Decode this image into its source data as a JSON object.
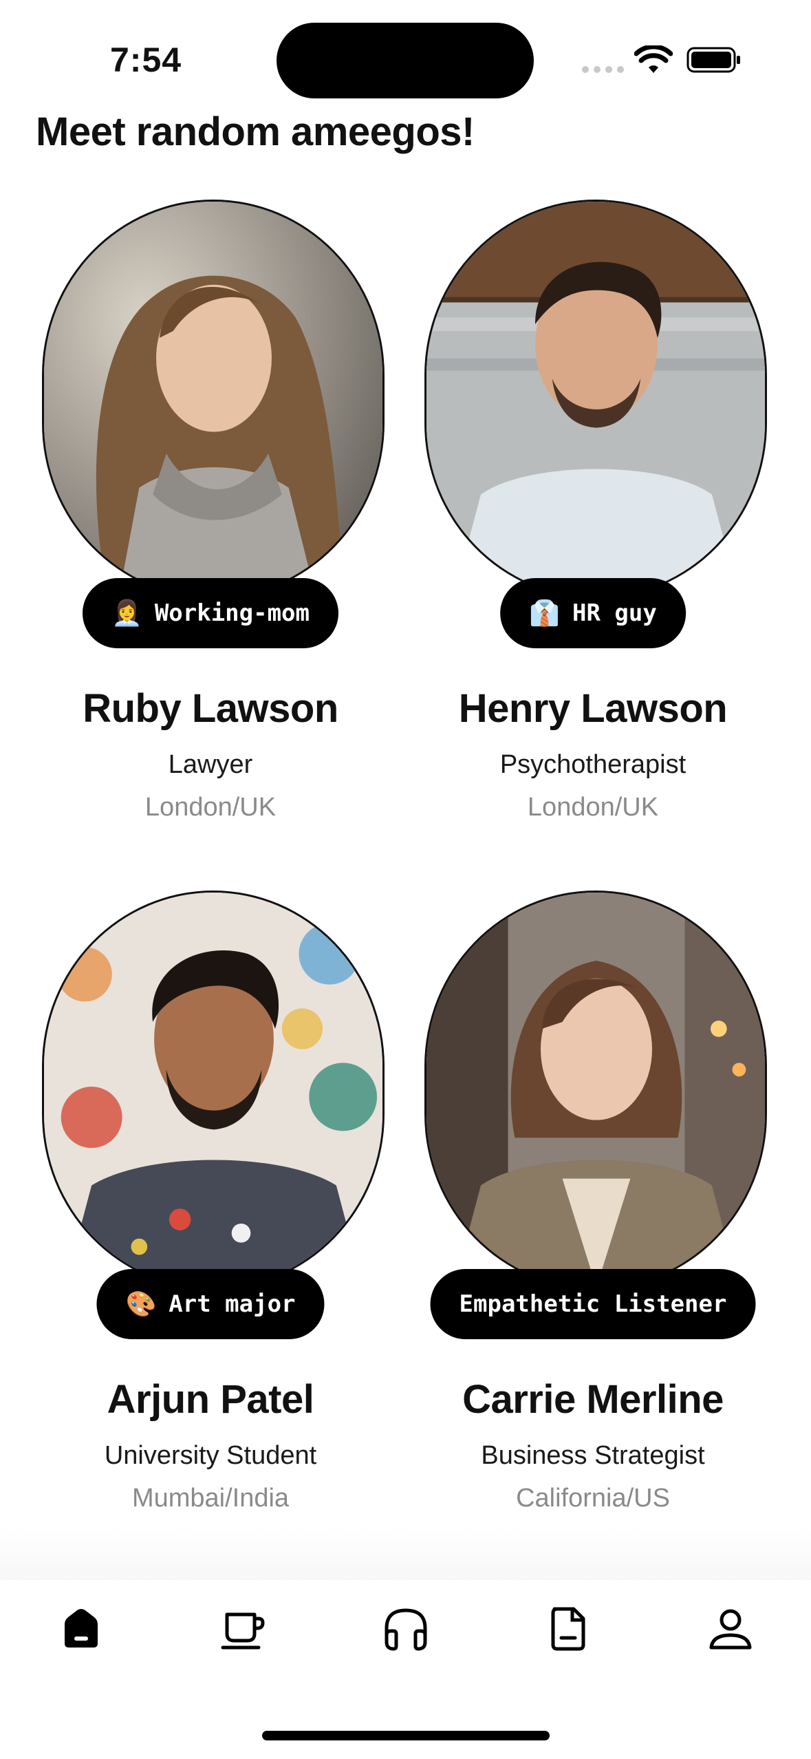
{
  "status_bar": {
    "time": "7:54"
  },
  "page": {
    "title": "Meet random ameegos!"
  },
  "profiles": [
    {
      "name": "Ruby Lawson",
      "job": "Lawyer",
      "location": "London/UK",
      "badge_emoji": "👩‍💼",
      "badge_text": "Working-mom"
    },
    {
      "name": "Henry Lawson",
      "job": "Psychotherapist",
      "location": "London/UK",
      "badge_emoji": "👔",
      "badge_text": "HR guy"
    },
    {
      "name": "Arjun Patel",
      "job": "University Student",
      "location": "Mumbai/India",
      "badge_emoji": "🎨",
      "badge_text": "Art major"
    },
    {
      "name": "Carrie Merline",
      "job": "Business Strategist",
      "location": "California/US",
      "badge_emoji": "",
      "badge_text": "Empathetic Listener"
    }
  ],
  "tab_bar": {
    "tabs": [
      {
        "icon": "home-icon",
        "active": true
      },
      {
        "icon": "cup-icon",
        "active": false
      },
      {
        "icon": "headphones-icon",
        "active": false
      },
      {
        "icon": "document-icon",
        "active": false
      },
      {
        "icon": "profile-icon",
        "active": false
      }
    ]
  },
  "colors": {
    "text": "#111111",
    "secondary": "#8a8a8a",
    "badge_bg": "#000000",
    "badge_text": "#ffffff"
  }
}
